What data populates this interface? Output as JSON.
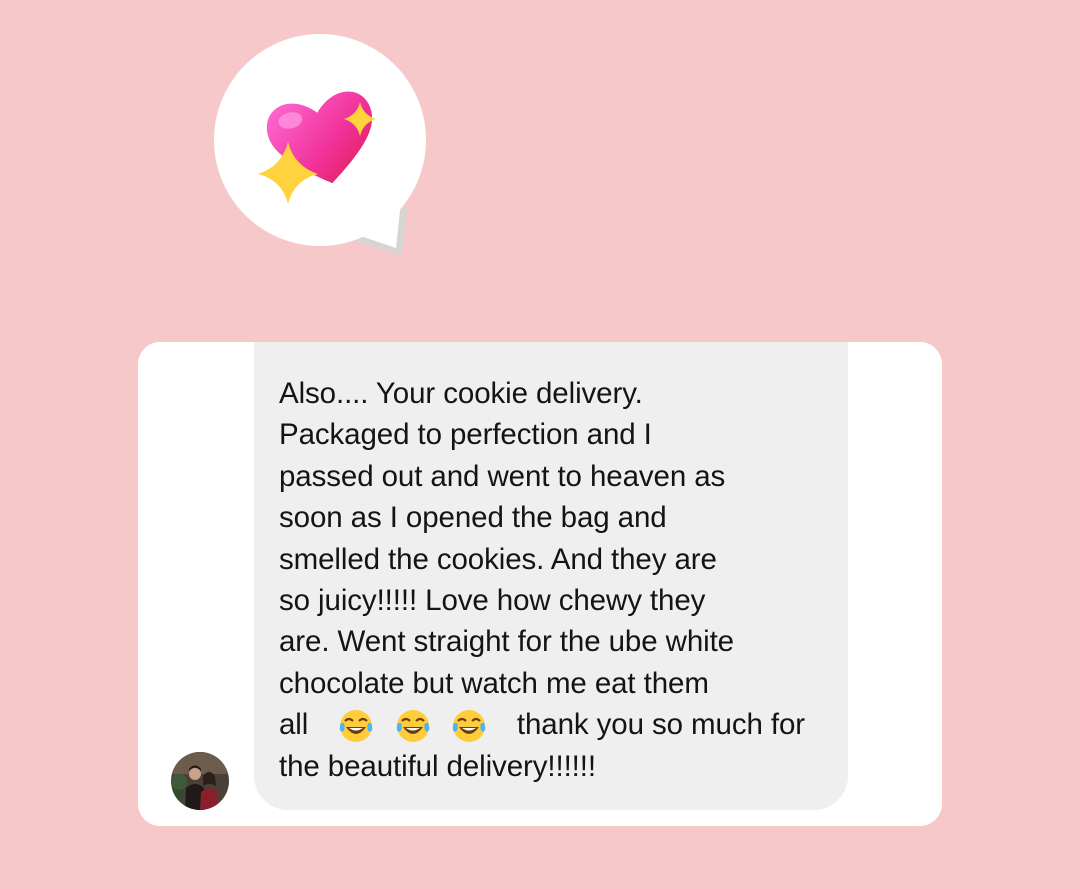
{
  "reaction": {
    "icon": "sparkling-heart-icon"
  },
  "message": {
    "avatar_icon": "profile-photo-avatar",
    "lines": [
      "Also.... Your cookie delivery.",
      "Packaged to perfection and I",
      "passed out and went to heaven as",
      "soon as I opened the bag and",
      "smelled the cookies. And they are",
      "so juicy!!!!! Love how chewy they",
      "are. Went straight for the ube white",
      "chocolate but watch me eat them"
    ],
    "emoji_line_prefix": "all",
    "emoji_icon": "face-with-tears-of-joy-icon",
    "emoji_count": 3,
    "emoji_line_suffix": "thank you so much for",
    "last_line": "the beautiful delivery!!!!!!"
  },
  "colors": {
    "background": "#f6c8c9",
    "card": "#ffffff",
    "bubble": "#efefef",
    "text": "#141414"
  }
}
